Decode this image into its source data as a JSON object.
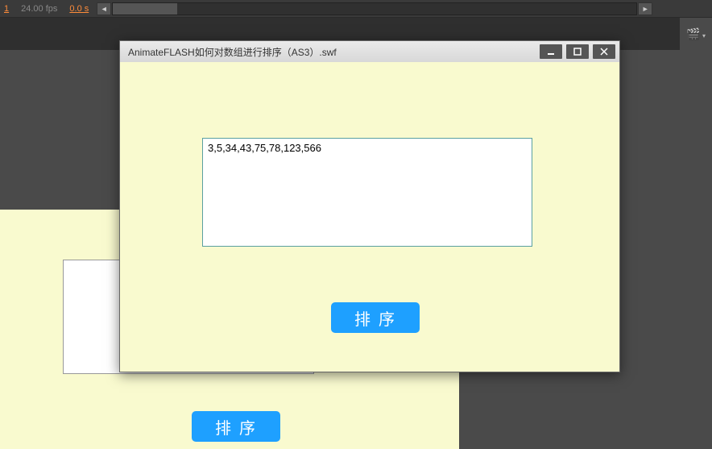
{
  "status_bar": {
    "frame": "1",
    "fps": "24.00 fps",
    "seconds": "0.0 s"
  },
  "swf_window": {
    "title": "AnimateFLASH如何对数组进行排序（AS3）.swf",
    "output_text": "3,5,34,43,75,78,123,566",
    "sort_button_label": "排序"
  },
  "bg_stage": {
    "sort_button_label": "排序"
  }
}
